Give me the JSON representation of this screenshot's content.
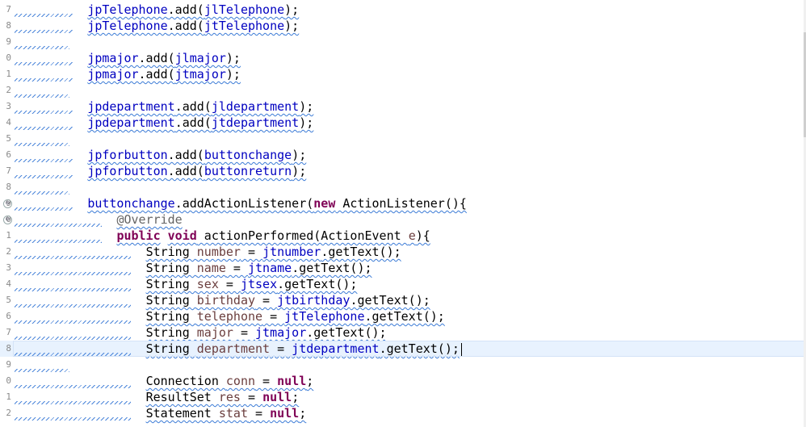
{
  "editor": {
    "lines": [
      {
        "gutter": "7",
        "indent": "          ",
        "tokens": [
          {
            "t": "jpTelephone",
            "c": "field"
          },
          {
            "t": ".add(",
            "c": ""
          },
          {
            "t": "jlTelephone",
            "c": "field"
          },
          {
            "t": ");",
            "c": ""
          }
        ]
      },
      {
        "gutter": "8",
        "indent": "          ",
        "tokens": [
          {
            "t": "jpTelephone",
            "c": "field"
          },
          {
            "t": ".add(",
            "c": ""
          },
          {
            "t": "jtTelephone",
            "c": "field"
          },
          {
            "t": ");",
            "c": ""
          }
        ]
      },
      {
        "gutter": "9",
        "indent": "",
        "tokens": []
      },
      {
        "gutter": "0",
        "indent": "          ",
        "tokens": [
          {
            "t": "jpmajor",
            "c": "field"
          },
          {
            "t": ".add(",
            "c": ""
          },
          {
            "t": "jlmajor",
            "c": "field"
          },
          {
            "t": ");",
            "c": ""
          }
        ]
      },
      {
        "gutter": "1",
        "indent": "          ",
        "tokens": [
          {
            "t": "jpmajor",
            "c": "field"
          },
          {
            "t": ".add(",
            "c": ""
          },
          {
            "t": "jtmajor",
            "c": "field"
          },
          {
            "t": ");",
            "c": ""
          }
        ]
      },
      {
        "gutter": "2",
        "indent": "",
        "tokens": []
      },
      {
        "gutter": "3",
        "indent": "          ",
        "tokens": [
          {
            "t": "jpdepartment",
            "c": "field"
          },
          {
            "t": ".add(",
            "c": ""
          },
          {
            "t": "jldepartment",
            "c": "field"
          },
          {
            "t": ");",
            "c": ""
          }
        ]
      },
      {
        "gutter": "4",
        "indent": "          ",
        "tokens": [
          {
            "t": "jpdepartment",
            "c": "field"
          },
          {
            "t": ".add(",
            "c": ""
          },
          {
            "t": "jtdepartment",
            "c": "field"
          },
          {
            "t": ");",
            "c": ""
          }
        ]
      },
      {
        "gutter": "5",
        "indent": "",
        "tokens": []
      },
      {
        "gutter": "6",
        "indent": "          ",
        "tokens": [
          {
            "t": "jpforbutton",
            "c": "field"
          },
          {
            "t": ".add(",
            "c": ""
          },
          {
            "t": "buttonchange",
            "c": "field"
          },
          {
            "t": ");",
            "c": ""
          }
        ]
      },
      {
        "gutter": "7",
        "indent": "          ",
        "tokens": [
          {
            "t": "jpforbutton",
            "c": "field"
          },
          {
            "t": ".add(",
            "c": ""
          },
          {
            "t": "buttonreturn",
            "c": "field"
          },
          {
            "t": ");",
            "c": ""
          }
        ]
      },
      {
        "gutter": "8",
        "indent": "",
        "tokens": []
      },
      {
        "gutter": "9",
        "fold": "⊖",
        "indent": "          ",
        "tokens": [
          {
            "t": "buttonchange",
            "c": "field"
          },
          {
            "t": ".addActionListener(",
            "c": ""
          },
          {
            "t": "new",
            "c": "kw"
          },
          {
            "t": " ActionListener(){",
            "c": ""
          }
        ]
      },
      {
        "gutter": "0",
        "fold": "⊖",
        "indent": "              ",
        "tokens": [
          {
            "t": "@Override",
            "c": "anno"
          }
        ]
      },
      {
        "gutter": "1",
        "indent": "              ",
        "tokens": [
          {
            "t": "public",
            "c": "kw"
          },
          {
            "t": " ",
            "c": ""
          },
          {
            "t": "void",
            "c": "kw"
          },
          {
            "t": " actionPerformed(ActionEvent ",
            "c": ""
          },
          {
            "t": "e",
            "c": "local"
          },
          {
            "t": "){",
            "c": ""
          }
        ]
      },
      {
        "gutter": "2",
        "indent": "                  ",
        "tokens": [
          {
            "t": "String ",
            "c": ""
          },
          {
            "t": "number",
            "c": "local"
          },
          {
            "t": " = ",
            "c": ""
          },
          {
            "t": "jtnumber",
            "c": "field"
          },
          {
            "t": ".getText();",
            "c": ""
          }
        ]
      },
      {
        "gutter": "3",
        "indent": "                  ",
        "tokens": [
          {
            "t": "String ",
            "c": ""
          },
          {
            "t": "name",
            "c": "local"
          },
          {
            "t": " = ",
            "c": ""
          },
          {
            "t": "jtname",
            "c": "field"
          },
          {
            "t": ".getText();",
            "c": ""
          }
        ]
      },
      {
        "gutter": "4",
        "indent": "                  ",
        "tokens": [
          {
            "t": "String ",
            "c": ""
          },
          {
            "t": "sex",
            "c": "local"
          },
          {
            "t": " = ",
            "c": ""
          },
          {
            "t": "jtsex",
            "c": "field"
          },
          {
            "t": ".getText();",
            "c": ""
          }
        ]
      },
      {
        "gutter": "5",
        "indent": "                  ",
        "tokens": [
          {
            "t": "String ",
            "c": ""
          },
          {
            "t": "birthday",
            "c": "local"
          },
          {
            "t": " = ",
            "c": ""
          },
          {
            "t": "jtbirthday",
            "c": "field"
          },
          {
            "t": ".getText();",
            "c": ""
          }
        ]
      },
      {
        "gutter": "6",
        "indent": "                  ",
        "tokens": [
          {
            "t": "String ",
            "c": ""
          },
          {
            "t": "telephone",
            "c": "local"
          },
          {
            "t": " = ",
            "c": ""
          },
          {
            "t": "jtTelephone",
            "c": "field"
          },
          {
            "t": ".getText();",
            "c": ""
          }
        ]
      },
      {
        "gutter": "7",
        "indent": "                  ",
        "tokens": [
          {
            "t": "String ",
            "c": ""
          },
          {
            "t": "major",
            "c": "local"
          },
          {
            "t": " = ",
            "c": ""
          },
          {
            "t": "jtmajor",
            "c": "field"
          },
          {
            "t": ".getText();",
            "c": ""
          }
        ]
      },
      {
        "gutter": "8",
        "current": true,
        "indent": "                  ",
        "tokens": [
          {
            "t": "String ",
            "c": ""
          },
          {
            "t": "department",
            "c": "local"
          },
          {
            "t": " = ",
            "c": ""
          },
          {
            "t": "jtdepartment",
            "c": "field"
          },
          {
            "t": ".getText();",
            "c": ""
          }
        ]
      },
      {
        "gutter": "9",
        "indent": "",
        "tokens": []
      },
      {
        "gutter": "0",
        "indent": "                  ",
        "tokens": [
          {
            "t": "Connection ",
            "c": ""
          },
          {
            "t": "conn",
            "c": "local"
          },
          {
            "t": " = ",
            "c": ""
          },
          {
            "t": "null",
            "c": "kw"
          },
          {
            "t": ";",
            "c": ""
          }
        ]
      },
      {
        "gutter": "1",
        "indent": "                  ",
        "tokens": [
          {
            "t": "ResultSet ",
            "c": ""
          },
          {
            "t": "res",
            "c": "local"
          },
          {
            "t": " = ",
            "c": ""
          },
          {
            "t": "null",
            "c": "kw"
          },
          {
            "t": ";",
            "c": ""
          }
        ]
      },
      {
        "gutter": "2",
        "indent": "                  ",
        "tokens": [
          {
            "t": "Statement ",
            "c": ""
          },
          {
            "t": "stat",
            "c": "local"
          },
          {
            "t": " = ",
            "c": ""
          },
          {
            "t": "null",
            "c": "kw"
          },
          {
            "t": ";",
            "c": ""
          }
        ]
      }
    ]
  }
}
